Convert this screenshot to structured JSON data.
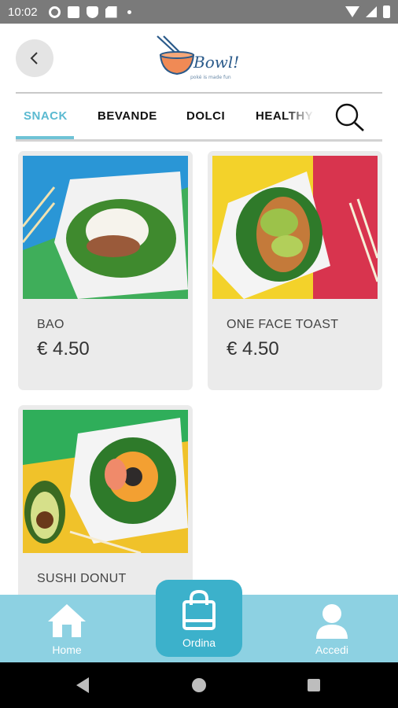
{
  "status_bar": {
    "time": "10:02",
    "icons": [
      "gear-icon",
      "square-icon",
      "shield-icon",
      "sd-card-icon",
      "dot-icon",
      "wifi-icon",
      "signal-icon",
      "battery-icon"
    ]
  },
  "header": {
    "back_icon": "chevron-left-icon",
    "logo": {
      "wordmark": "Bowl!",
      "tagline": "poké is made fun"
    }
  },
  "tabs": [
    {
      "label": "SNACK",
      "active": true
    },
    {
      "label": "BEVANDE",
      "active": false
    },
    {
      "label": "DOLCI",
      "active": false
    },
    {
      "label": "HEALTHY",
      "active": false
    }
  ],
  "search_icon": "search-icon",
  "products": [
    {
      "name": "BAO",
      "price": "€ 4.50"
    },
    {
      "name": "ONE FACE TOAST",
      "price": "€ 4.50"
    },
    {
      "name": "SUSHI DONUT",
      "price": ""
    }
  ],
  "bottom_nav": {
    "home_label": "Home",
    "order_label": "Ordina",
    "login_label": "Accedi"
  },
  "colors": {
    "accent": "#5bbad1",
    "nav_bg": "#8dd1e2",
    "order_bg": "#3cb1cb",
    "status_bar": "#7a7a7a",
    "card_bg": "#ebebeb"
  }
}
